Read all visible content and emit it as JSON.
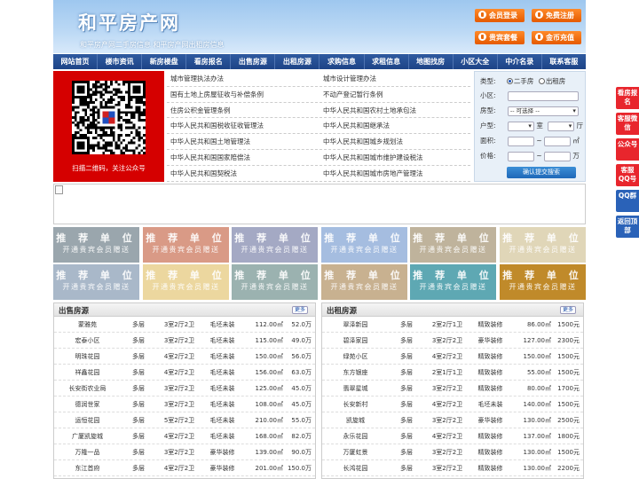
{
  "header": {
    "title": "和平房产网",
    "tagline": "和平房产网二手房信息    和平房产网出租房信息",
    "buttons": [
      {
        "label": "会员登录",
        "icon": "user-icon"
      },
      {
        "label": "免费注册",
        "icon": "register-icon"
      },
      {
        "label": "贵宾套餐",
        "icon": "package-icon"
      },
      {
        "label": "金币充值",
        "icon": "coin-icon"
      }
    ],
    "button_color": "#f07414"
  },
  "nav": [
    "网站首页",
    "楼市资讯",
    "新房楼盘",
    "看房报名",
    "出售房源",
    "出租房源",
    "求购信息",
    "求租信息",
    "地图找房",
    "小区大全",
    "中介名录",
    "联系客服"
  ],
  "qr": {
    "caption": "扫描二维码，关注公众号"
  },
  "links": {
    "left": [
      "城市管理执法办法",
      "国有土地上房屋征收与补偿条例",
      "住房公积金管理条例",
      "中华人民共和国税收征收管理法",
      "中华人民共和国土地管理法",
      "中华人民共和国国家赔偿法",
      "中华人民共和国契税法"
    ],
    "right": [
      "城市设计管理办法",
      "不动产登记暂行条例",
      "中华人民共和国农村土地承包法",
      "中华人民共和国继承法",
      "中华人民共和国城乡规划法",
      "中华人民共和国城市维护建设税法",
      "中华人民共和国城市房地产管理法"
    ]
  },
  "search": {
    "type_label": "类型:",
    "type_options": [
      "二手房",
      "出租房"
    ],
    "community_label": "小区:",
    "house_type_label": "房型:",
    "house_type_value": "-- 可选择 --",
    "layout_label": "户型:",
    "room_unit": "室",
    "hall_unit": "厅",
    "area_label": "面积:",
    "area_unit": "㎡",
    "price_label": "价格:",
    "price_unit": "万",
    "range_sep": "~",
    "submit": "确认提交搜索"
  },
  "promo": {
    "line1": "推 荐 单 位",
    "line2": "开通贵宾会员赠送",
    "colors": [
      "#9aa6ad",
      "#d99a86",
      "#a4a9c4",
      "#a5bde0",
      "#bfb39c",
      "#e0d6b8",
      "#a9b8c9",
      "#ecd79f",
      "#9bb2b0",
      "#c8b190",
      "#5ea8b3",
      "#c08a2a"
    ]
  },
  "sale": {
    "title": "出售房源",
    "more": "更多",
    "rows": [
      [
        "蒙雅苑",
        "多层",
        "3室2厅2卫",
        "毛坯未装",
        "112.00㎡",
        "52.0万"
      ],
      [
        "宏泰小区",
        "多层",
        "3室2厅2卫",
        "毛坯未装",
        "115.00㎡",
        "49.0万"
      ],
      [
        "明珠花园",
        "多层",
        "4室2厅2卫",
        "毛坯未装",
        "150.00㎡",
        "56.0万"
      ],
      [
        "祥鑫花园",
        "多层",
        "4室2厅2卫",
        "毛坯未装",
        "156.00㎡",
        "63.0万"
      ],
      [
        "长安街农业局",
        "多层",
        "3室2厅2卫",
        "毛坯未装",
        "125.00㎡",
        "45.0万"
      ],
      [
        "德润世家",
        "多层",
        "3室2厅2卫",
        "毛坯未装",
        "108.00㎡",
        "45.0万"
      ],
      [
        "运恒花园",
        "多层",
        "5室2厅2卫",
        "毛坯未装",
        "210.00㎡",
        "55.0万"
      ],
      [
        "广厦凯旋城",
        "多层",
        "4室2厅2卫",
        "毛坯未装",
        "168.00㎡",
        "82.0万"
      ],
      [
        "万隆一品",
        "多层",
        "3室2厅2卫",
        "豪华装修",
        "139.00㎡",
        "90.0万"
      ],
      [
        "东江首府",
        "多层",
        "4室2厅2卫",
        "豪华装修",
        "201.00㎡",
        "150.0万"
      ]
    ]
  },
  "rent": {
    "title": "出租房源",
    "more": "更多",
    "rows": [
      [
        "翠泽新园",
        "多层",
        "2室2厅1卫",
        "精致装修",
        "86.00㎡",
        "1500元"
      ],
      [
        "碧泽家园",
        "多层",
        "3室2厅2卫",
        "豪华装修",
        "127.00㎡",
        "2300元"
      ],
      [
        "绿苑小区",
        "多层",
        "4室2厅2卫",
        "精致装修",
        "150.00㎡",
        "1500元"
      ],
      [
        "东方银座",
        "多层",
        "2室1厅1卫",
        "精致装修",
        "55.00㎡",
        "1500元"
      ],
      [
        "翡翠星城",
        "多层",
        "3室2厅2卫",
        "精致装修",
        "80.00㎡",
        "1700元"
      ],
      [
        "长安新村",
        "多层",
        "4室2厅2卫",
        "毛坯未装",
        "140.00㎡",
        "1500元"
      ],
      [
        "凯旋城",
        "多层",
        "3室2厅2卫",
        "豪华装修",
        "130.00㎡",
        "2500元"
      ],
      [
        "永乐花园",
        "多层",
        "4室2厅2卫",
        "精致装修",
        "137.00㎡",
        "1800元"
      ],
      [
        "万厦虹景",
        "多层",
        "3室2厅2卫",
        "精致装修",
        "130.00㎡",
        "1500元"
      ],
      [
        "长鸿花园",
        "多层",
        "3室2厅2卫",
        "精致装修",
        "130.00㎡",
        "2200元"
      ]
    ]
  },
  "float_bar": [
    {
      "label": "看房报名",
      "color": "#e8262d"
    },
    {
      "label": "客服微信",
      "color": "#e8262d"
    },
    {
      "label": "公众号",
      "color": "#e8262d"
    },
    {
      "label": "客服QQ号",
      "color": "#e8262d"
    },
    {
      "label": "QQ群",
      "color": "#2a62b8"
    },
    {
      "label": "返回顶部",
      "color": "#2a62b8"
    }
  ]
}
